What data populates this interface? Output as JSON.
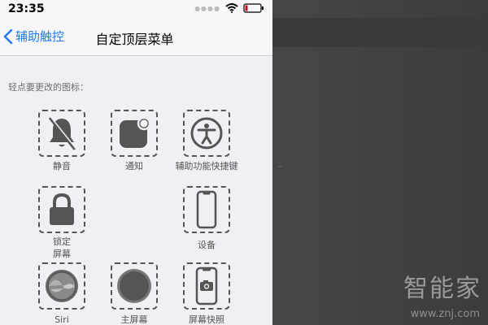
{
  "status": {
    "time": "23:35"
  },
  "nav": {
    "back_label": "辅助触控",
    "title": "自定顶层菜单"
  },
  "section": {
    "label": "轻点要更改的图标："
  },
  "icons": [
    {
      "name": "mute",
      "label": "静音",
      "icon": "bell-slash-icon"
    },
    {
      "name": "notifications",
      "label": "通知",
      "icon": "notification-icon"
    },
    {
      "name": "accessibility-shortcut",
      "label": "辅助功能快捷键",
      "icon": "accessibility-icon"
    },
    {
      "name": "lock-screen",
      "label": "锁定\n屏幕",
      "icon": "lock-icon"
    },
    {
      "name": "device",
      "label": "设备",
      "icon": "iphone-icon"
    },
    {
      "name": "siri",
      "label": "Siri",
      "icon": "siri-icon"
    },
    {
      "name": "home",
      "label": "主屏幕",
      "icon": "home-button-icon"
    },
    {
      "name": "screenshot",
      "label": "屏幕快照",
      "icon": "screenshot-icon"
    }
  ],
  "watermark": {
    "brand": "智能家",
    "url": "www.znj.com"
  }
}
